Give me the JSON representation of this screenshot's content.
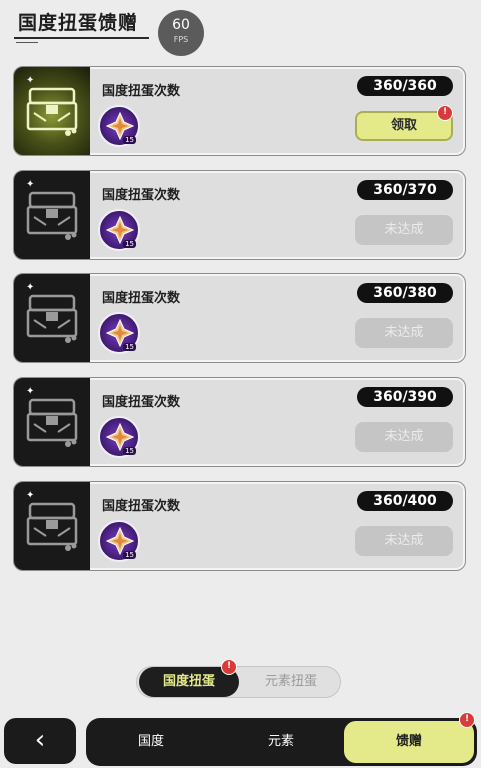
{
  "header": {
    "title": "国度扭蛋馈赠",
    "fps_value": "60",
    "fps_label": "FPS"
  },
  "cards": [
    {
      "label": "国度扭蛋次数",
      "count": "360/360",
      "button": "领取",
      "state": "claim",
      "reward_qty": "15",
      "alert": "!"
    },
    {
      "label": "国度扭蛋次数",
      "count": "360/370",
      "button": "未达成",
      "state": "disabled",
      "reward_qty": "15"
    },
    {
      "label": "国度扭蛋次数",
      "count": "360/380",
      "button": "未达成",
      "state": "disabled",
      "reward_qty": "15"
    },
    {
      "label": "国度扭蛋次数",
      "count": "360/390",
      "button": "未达成",
      "state": "disabled",
      "reward_qty": "15"
    },
    {
      "label": "国度扭蛋次数",
      "count": "360/400",
      "button": "未达成",
      "state": "disabled",
      "reward_qty": "15"
    }
  ],
  "subtabs": {
    "active": "国度扭蛋",
    "inactive": "元素扭蛋",
    "alert": "!"
  },
  "nav": {
    "back_icon": "‹",
    "items": [
      "国度",
      "元素",
      "馈赠"
    ],
    "alert": "!"
  },
  "colors": {
    "accent": "#e4ea8a",
    "dark": "#1b1b1b",
    "alert": "#d93b3b",
    "background": "#ececec"
  },
  "icons": {
    "chest": "treasure-chest-icon",
    "reward": "star-crystal-icon",
    "back": "back-arrow-icon"
  }
}
